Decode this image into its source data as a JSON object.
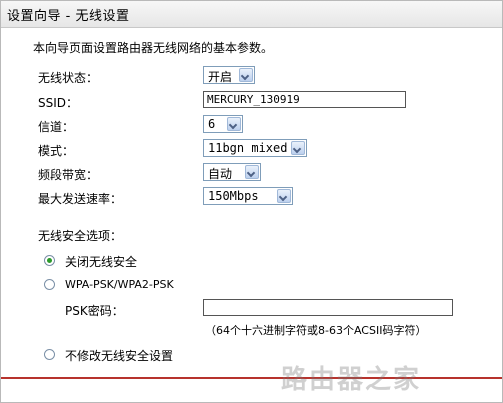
{
  "header": {
    "title": "设置向导 - 无线设置"
  },
  "intro": "本向导页面设置路由器无线网络的基本参数。",
  "form": {
    "wireless_status": {
      "label": "无线状态：",
      "value": "开启"
    },
    "ssid": {
      "label": "SSID：",
      "value": "MERCURY_130919"
    },
    "channel": {
      "label": "信道：",
      "value": "6"
    },
    "mode": {
      "label": "模式：",
      "value": "11bgn mixed"
    },
    "bandwidth": {
      "label": "频段带宽：",
      "value": "自动"
    },
    "max_rate": {
      "label": "最大发送速率：",
      "value": "150Mbps"
    }
  },
  "security": {
    "title": "无线安全选项：",
    "option_off": "关闭无线安全",
    "option_wpa": "WPA-PSK/WPA2-PSK",
    "psk_label": "PSK密码：",
    "psk_value": "",
    "psk_hint": "（64个十六进制字符或8-63个ACSII码字符）",
    "option_keep": "不修改无线安全设置",
    "selected": "off"
  },
  "watermark": "路由器之家",
  "colors": {
    "accent_line": "#b7332d",
    "radio_on": "#2b9a2b",
    "select_border": "#7f9db9"
  }
}
